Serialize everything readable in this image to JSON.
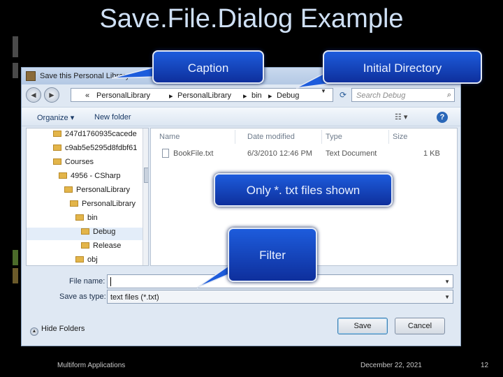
{
  "slide": {
    "title": "Save.File.Dialog Example",
    "footer_left": "Multiform Applications",
    "footer_date": "December 22, 2021",
    "page_number": "12"
  },
  "dialog": {
    "title": "Save this Personal Library",
    "back_arrow": "◄",
    "forward_arrow": "►",
    "address_prefix": "«",
    "address_segments": [
      "PersonalLibrary",
      "PersonalLibrary",
      "bin",
      "Debug"
    ],
    "address_separator": "▸",
    "search_placeholder": "Search Debug",
    "organize_label": "Organize ▾",
    "new_folder_label": "New folder",
    "view_label": "☷  ▾",
    "help_label": "?",
    "tree_items": [
      "247d1760935cacede",
      "c9ab5e5295d8fdbf61",
      "Courses",
      "4956 - CSharp",
      "PersonalLibrary",
      "PersonalLibrary",
      "bin",
      "Debug",
      "Release",
      "obj"
    ],
    "columns": [
      "Name",
      "Date modified",
      "Type",
      "Size"
    ],
    "file": {
      "name": "BookFile.txt",
      "date": "6/3/2010 12:46 PM",
      "type": "Text Document",
      "size": "1 KB"
    },
    "filename_label": "File name:",
    "filename_value": "",
    "saveas_label": "Save as type:",
    "saveas_value": "text files (*.txt)",
    "hide_folders_label": "Hide Folders",
    "save_label": "Save",
    "cancel_label": "Cancel"
  },
  "callouts": {
    "caption": "Caption",
    "initial_directory": "Initial Directory",
    "txt_only": "Only *. txt files shown",
    "filter": "Filter"
  },
  "colors": {
    "callout_fill": "#1d5cdc",
    "slide_background": "#000000",
    "title_text": "#cfe0f5"
  }
}
